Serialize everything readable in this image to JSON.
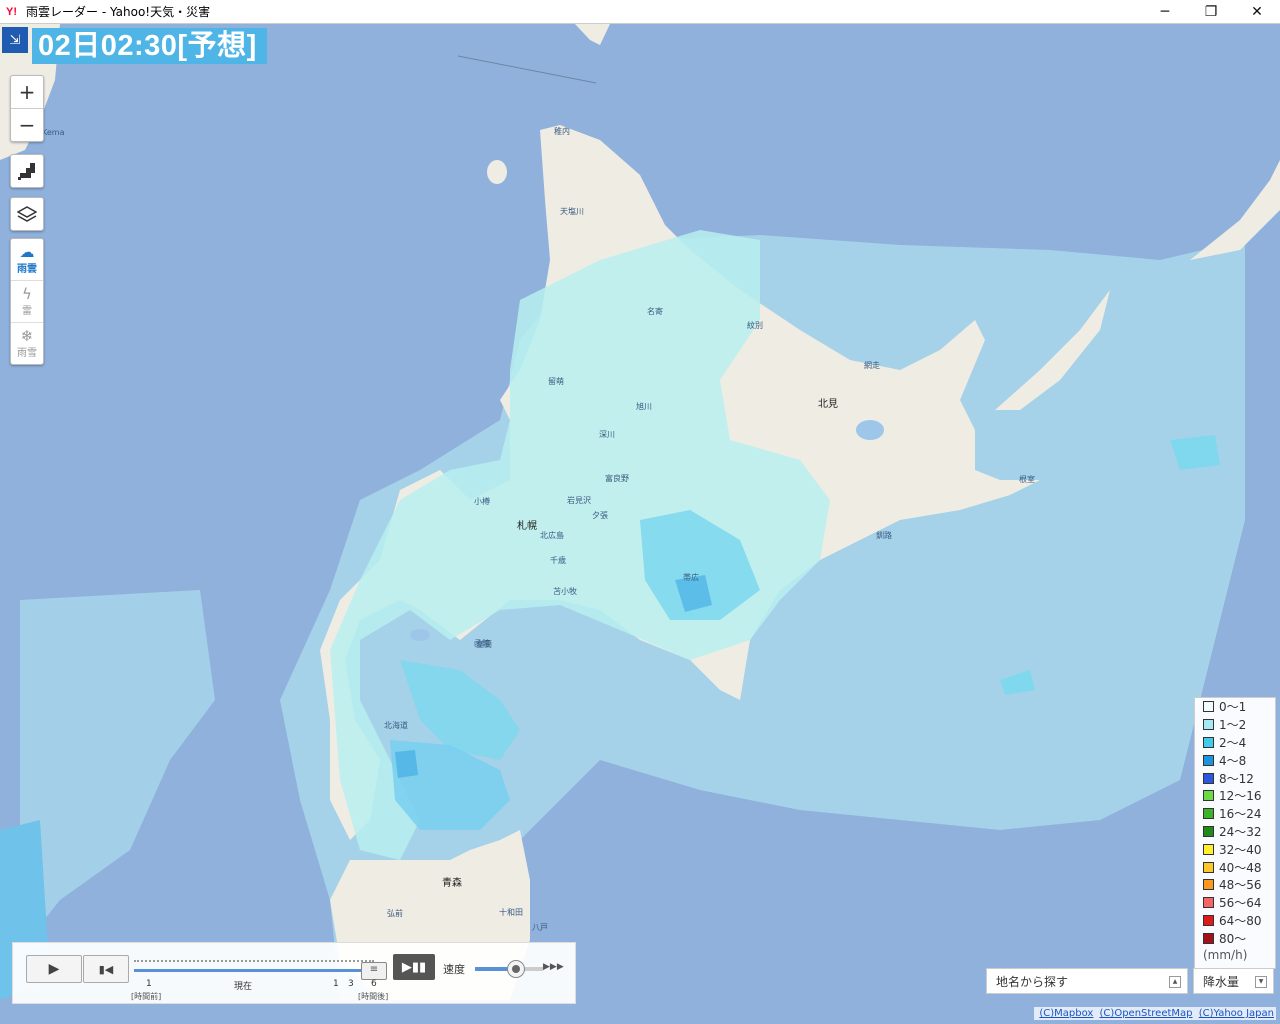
{
  "window": {
    "logo": "Y!",
    "title": "雨雲レーダー - Yahoo!天気・災害",
    "minimize": "─",
    "restore": "❐",
    "close": "✕"
  },
  "map": {
    "time_label": "02日02:30[予想]",
    "controls": {
      "zoom_in": "+",
      "zoom_out": "−"
    },
    "layers": [
      {
        "label": "雨雲",
        "active": true
      },
      {
        "label": "雷",
        "active": false
      },
      {
        "label": "雨雪",
        "active": false
      }
    ],
    "places": [
      {
        "name": "稚内",
        "big": false
      },
      {
        "name": "名寄",
        "big": false
      },
      {
        "name": "留萌",
        "big": false
      },
      {
        "name": "旭川",
        "big": false
      },
      {
        "name": "北見",
        "big": false
      },
      {
        "name": "網走",
        "big": false
      },
      {
        "name": "札幌",
        "big": true
      },
      {
        "name": "苫小牧",
        "big": false
      },
      {
        "name": "帯広",
        "big": false
      },
      {
        "name": "釧路",
        "big": false
      },
      {
        "name": "根室",
        "big": false
      },
      {
        "name": "函館",
        "big": false
      },
      {
        "name": "青森",
        "big": true
      },
      {
        "name": "弘前",
        "big": false
      },
      {
        "name": "十和田",
        "big": false
      },
      {
        "name": "八戸",
        "big": false
      },
      {
        "name": "北広島",
        "big": false
      },
      {
        "name": "富良野",
        "big": false
      },
      {
        "name": "夕張",
        "big": false
      },
      {
        "name": "岩見沢",
        "big": false
      },
      {
        "name": "小樽",
        "big": false
      },
      {
        "name": "室蘭",
        "big": false
      },
      {
        "name": "千歳",
        "big": false
      },
      {
        "name": "深川",
        "big": false
      },
      {
        "name": "紋別",
        "big": false
      },
      {
        "name": "天塩川",
        "big": false
      },
      {
        "name": "北海道",
        "big": false
      },
      {
        "name": "Kema",
        "big": false
      }
    ]
  },
  "player": {
    "play": "▶",
    "prev": "▮◀",
    "step": "▶▮▮",
    "thumb": "≡",
    "speed_label": "速度",
    "speed_arrows": "▶▶▶",
    "ticks": [
      "1",
      "現在",
      "1",
      "3",
      "6"
    ],
    "sub_before": "[時間前]",
    "sub_after": "[時間後]"
  },
  "legend": {
    "items": [
      {
        "label": "0〜1",
        "color": "#f2fbfd"
      },
      {
        "label": "1〜2",
        "color": "#a6e8f5"
      },
      {
        "label": "2〜4",
        "color": "#3fcbe9"
      },
      {
        "label": "4〜8",
        "color": "#1e93e0"
      },
      {
        "label": "8〜12",
        "color": "#2a56e0"
      },
      {
        "label": "12〜16",
        "color": "#6ad94a"
      },
      {
        "label": "16〜24",
        "color": "#3bb42c"
      },
      {
        "label": "24〜32",
        "color": "#228a1a"
      },
      {
        "label": "32〜40",
        "color": "#ffef2e"
      },
      {
        "label": "40〜48",
        "color": "#fbc72b"
      },
      {
        "label": "48〜56",
        "color": "#f99a1e"
      },
      {
        "label": "56〜64",
        "color": "#f56565"
      },
      {
        "label": "64〜80",
        "color": "#e0191b"
      },
      {
        "label": "80〜",
        "color": "#a3121a"
      }
    ],
    "unit": "(mm/h)"
  },
  "search": {
    "label": "地名から探す",
    "arrow": "▲"
  },
  "rain_select": {
    "label": "降水量",
    "arrow": "▼"
  },
  "attribution": {
    "mapbox": "(C)Mapbox",
    "osm": "(C)OpenStreetMap",
    "yahoo": "(C)Yahoo Japan"
  }
}
